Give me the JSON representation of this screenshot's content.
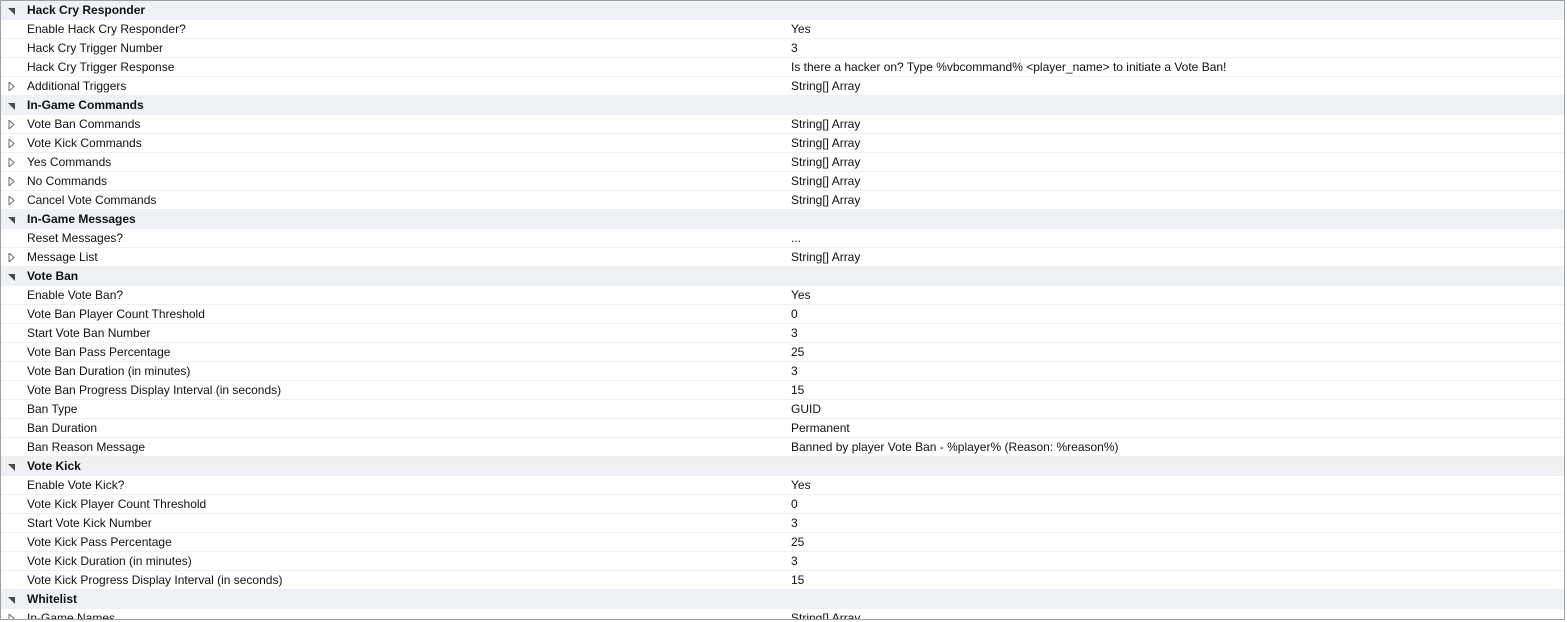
{
  "categories": [
    {
      "name": "Hack Cry Responder",
      "expanded": true,
      "items": [
        {
          "label": "Enable Hack Cry Responder?",
          "value": "Yes",
          "toggle": ""
        },
        {
          "label": "Hack Cry Trigger Number",
          "value": "3",
          "toggle": ""
        },
        {
          "label": "Hack Cry Trigger Response",
          "value": "Is there a hacker on? Type %vbcommand% <player_name> to initiate a Vote Ban!",
          "toggle": ""
        },
        {
          "label": "Additional Triggers",
          "value": "String[] Array",
          "toggle": "right"
        }
      ]
    },
    {
      "name": "In-Game Commands",
      "expanded": true,
      "items": [
        {
          "label": "Vote Ban Commands",
          "value": "String[] Array",
          "toggle": "right"
        },
        {
          "label": "Vote Kick Commands",
          "value": "String[] Array",
          "toggle": "right"
        },
        {
          "label": "Yes Commands",
          "value": "String[] Array",
          "toggle": "right"
        },
        {
          "label": "No Commands",
          "value": "String[] Array",
          "toggle": "right"
        },
        {
          "label": "Cancel Vote Commands",
          "value": "String[] Array",
          "toggle": "right"
        }
      ]
    },
    {
      "name": "In-Game Messages",
      "expanded": true,
      "items": [
        {
          "label": "Reset Messages?",
          "value": "...",
          "toggle": ""
        },
        {
          "label": "Message List",
          "value": "String[] Array",
          "toggle": "right"
        }
      ]
    },
    {
      "name": "Vote Ban",
      "expanded": true,
      "items": [
        {
          "label": "Enable Vote Ban?",
          "value": "Yes",
          "toggle": ""
        },
        {
          "label": "Vote Ban Player Count Threshold",
          "value": "0",
          "toggle": ""
        },
        {
          "label": "Start Vote Ban Number",
          "value": "3",
          "toggle": ""
        },
        {
          "label": "Vote Ban Pass Percentage",
          "value": "25",
          "toggle": ""
        },
        {
          "label": "Vote Ban Duration (in minutes)",
          "value": "3",
          "toggle": ""
        },
        {
          "label": "Vote Ban Progress Display Interval (in seconds)",
          "value": "15",
          "toggle": ""
        },
        {
          "label": "Ban Type",
          "value": "GUID",
          "toggle": ""
        },
        {
          "label": "Ban Duration",
          "value": "Permanent",
          "toggle": ""
        },
        {
          "label": "Ban Reason Message",
          "value": "Banned by player Vote Ban - %player% (Reason: %reason%)",
          "toggle": ""
        }
      ]
    },
    {
      "name": "Vote Kick",
      "expanded": true,
      "items": [
        {
          "label": "Enable Vote Kick?",
          "value": "Yes",
          "toggle": ""
        },
        {
          "label": "Vote Kick Player Count Threshold",
          "value": "0",
          "toggle": ""
        },
        {
          "label": "Start Vote Kick Number",
          "value": "3",
          "toggle": ""
        },
        {
          "label": "Vote Kick Pass Percentage",
          "value": "25",
          "toggle": ""
        },
        {
          "label": "Vote Kick Duration (in minutes)",
          "value": "3",
          "toggle": ""
        },
        {
          "label": "Vote Kick Progress Display Interval (in seconds)",
          "value": "15",
          "toggle": ""
        }
      ]
    },
    {
      "name": "Whitelist",
      "expanded": true,
      "items": [
        {
          "label": "In-Game Names",
          "value": "String[] Array",
          "toggle": "right"
        }
      ]
    }
  ]
}
